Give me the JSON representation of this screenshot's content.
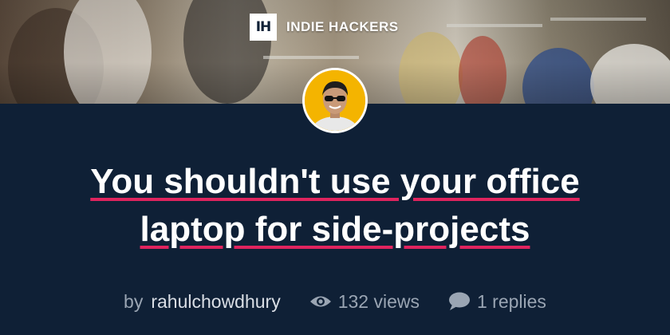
{
  "brand": {
    "logo_text": "IH",
    "name": "INDIE HACKERS"
  },
  "post": {
    "title_line1": "You shouldn't use your office",
    "title_line2": "laptop for side-projects",
    "by_label": "by",
    "author": "rahulchowdhury",
    "views": "132 views",
    "replies": "1 replies"
  },
  "icons": {
    "views": "eye-icon",
    "replies": "speech-bubble-icon"
  },
  "colors": {
    "background": "#0f2036",
    "underline_accent": "#e0245e",
    "avatar_bg": "#f4b400",
    "meta_text": "#9aa5b3"
  }
}
